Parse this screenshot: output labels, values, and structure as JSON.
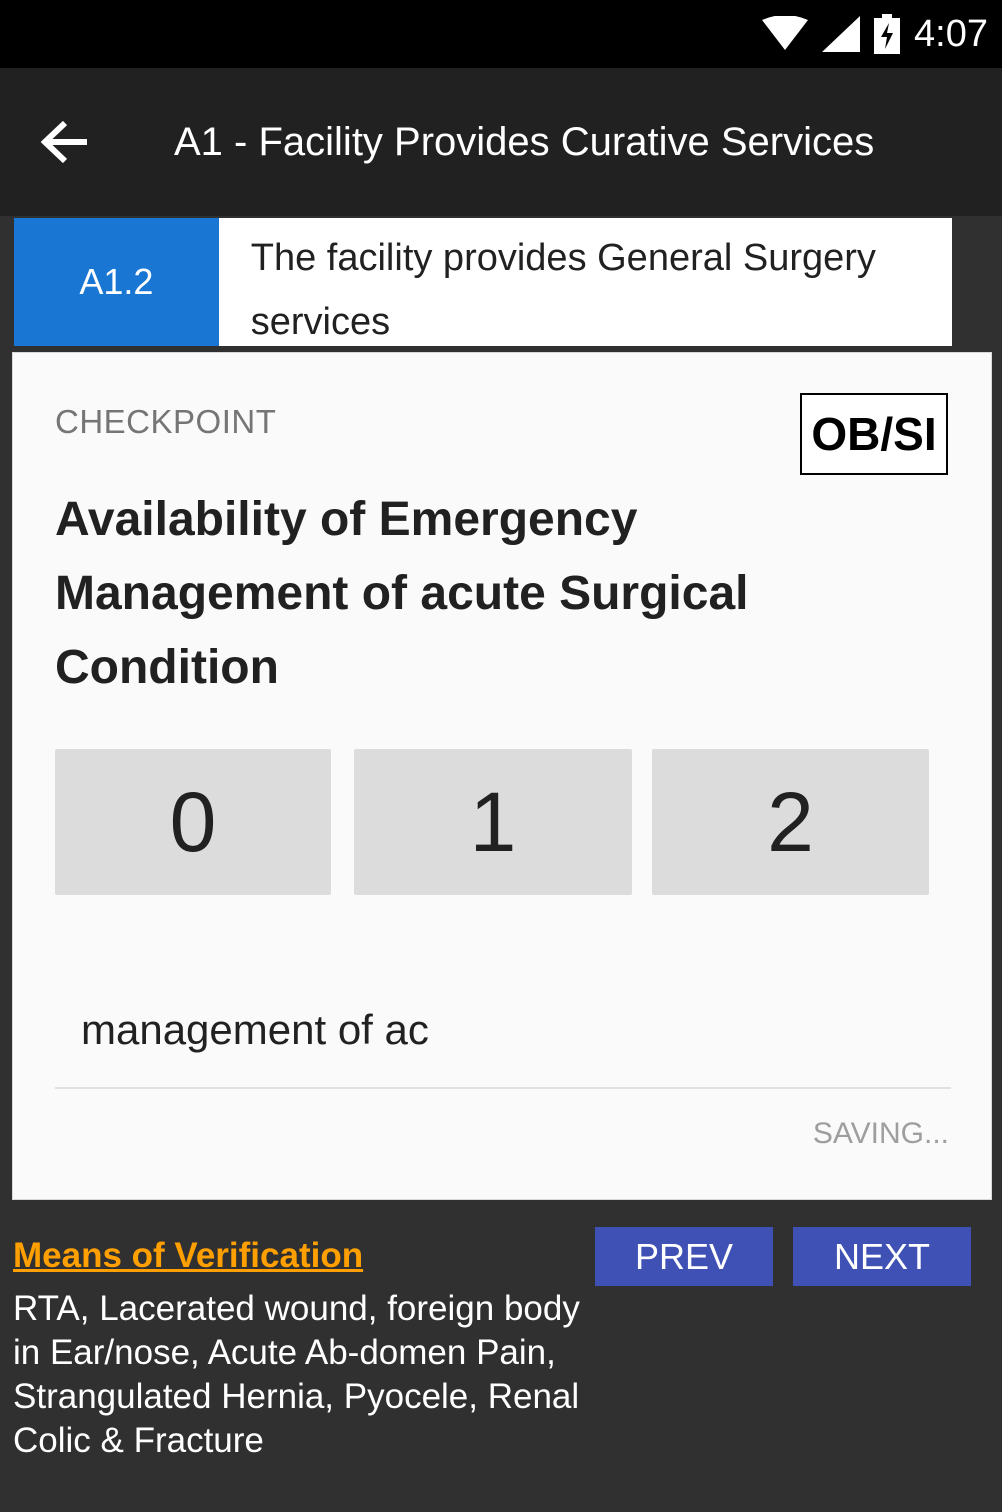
{
  "status_bar": {
    "time": "4:07",
    "icons": [
      "wifi-icon",
      "signal-icon",
      "battery-charging-icon"
    ]
  },
  "app_bar": {
    "back_icon": "arrow-back-icon",
    "title": "A1 - Facility Provides Curative Services"
  },
  "standard": {
    "code": "A1.2",
    "text": "The facility provides General Surgery services",
    "accent_color": "#1976d2"
  },
  "checkpoint": {
    "label": "CHECKPOINT",
    "method_badge": "OB/SI",
    "title": "Availability of Emergency Management of acute Surgical Condition",
    "scores": [
      "0",
      "1",
      "2"
    ],
    "remark_value": "management of ac",
    "status": "SAVING..."
  },
  "verification": {
    "link_label": "Means of Verification",
    "link_color": "#ffa000",
    "text": "RTA, Lacerated wound, foreign body in Ear/nose, Acute Ab-domen Pain, Strangulated Hernia, Pyocele, Renal Colic & Fracture"
  },
  "navigation": {
    "prev_label": "PREV",
    "next_label": "NEXT",
    "button_color": "#3f51b5"
  }
}
